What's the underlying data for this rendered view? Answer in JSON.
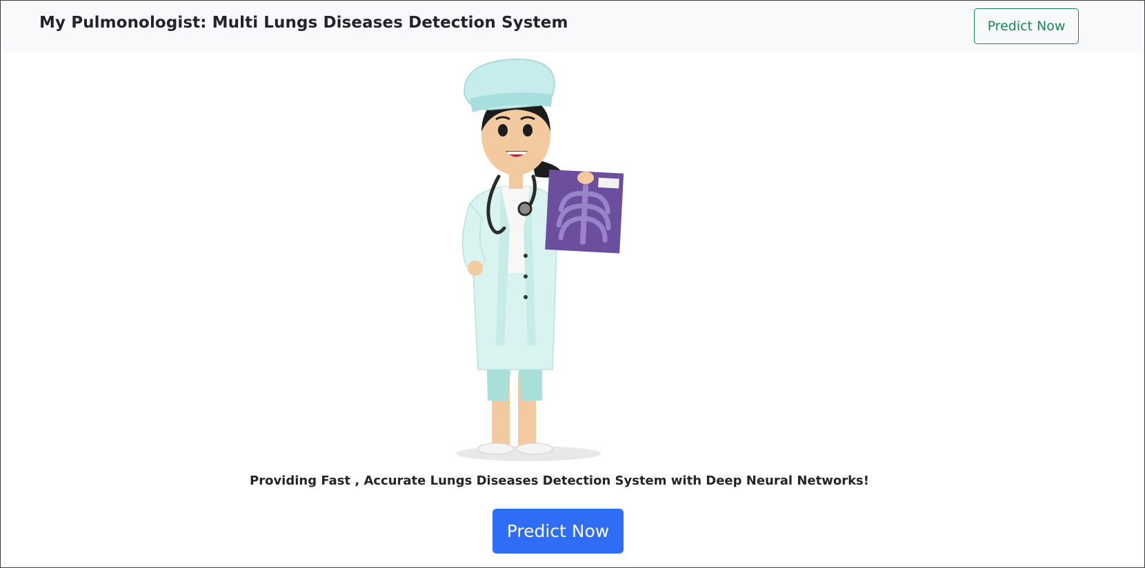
{
  "navbar": {
    "brand": "My Pulmonologist: Multi Lungs Diseases Detection System",
    "predict_button_label": "Predict Now"
  },
  "hero": {
    "illustration": "doctor-holding-chest-xray-illustration",
    "tagline": "Providing Fast , Accurate Lungs Diseases Detection System with Deep Neural Networks!",
    "predict_button_label": "Predict Now"
  },
  "colors": {
    "navbar_bg": "#f8f9fa",
    "outline_button": "#198754",
    "primary_button": "#2f6df6",
    "text": "#212529",
    "xray_film": "#6b4f9e"
  }
}
